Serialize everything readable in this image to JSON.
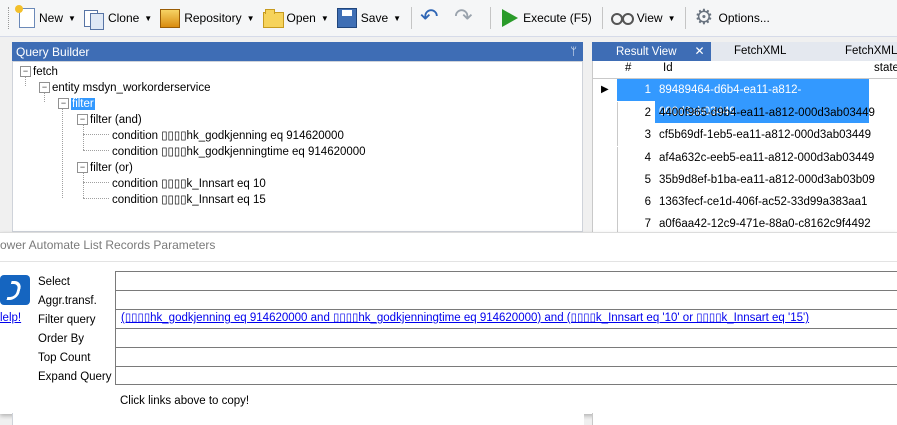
{
  "toolbar": {
    "new": "New",
    "clone": "Clone",
    "repository": "Repository",
    "open": "Open",
    "save": "Save",
    "execute": "Execute (F5)",
    "view": "View",
    "options": "Options..."
  },
  "query_builder": {
    "title": "Query Builder",
    "pin": "ᛘ",
    "tree": {
      "fetch": "fetch",
      "entity": "entity msdyn_workorderservice",
      "filter": "filter",
      "filter_and": "filter (and)",
      "cond1": "condition ▯▯▯▯hk_godkjenning eq 914620000",
      "cond2": "condition ▯▯▯▯hk_godkjenningtime eq 914620000",
      "filter_or": "filter (or)",
      "cond3": "condition ▯▯▯▯k_Innsart eq 10",
      "cond4": "condition ▯▯▯▯k_Innsart eq 15"
    }
  },
  "result_view": {
    "tabs": [
      "Result View",
      "FetchXML",
      "FetchXML"
    ],
    "close": "✕",
    "columns": [
      "#",
      "Id",
      "state"
    ],
    "rows": [
      {
        "n": "1",
        "id": "89489464-d6b4-ea11-a812-000d3ab03449"
      },
      {
        "n": "2",
        "id": "4400f965-d9b4-ea11-a812-000d3ab03449"
      },
      {
        "n": "3",
        "id": "cf5b69df-1eb5-ea11-a812-000d3ab03449"
      },
      {
        "n": "4",
        "id": "af4a632c-eeb5-ea11-a812-000d3ab03449"
      },
      {
        "n": "5",
        "id": "35b9d8ef-b1ba-ea11-a812-000d3ab03b09"
      },
      {
        "n": "6",
        "id": "1363fecf-ce1d-406f-ac52-33d99a383aa1"
      },
      {
        "n": "7",
        "id": "a0f6aa42-12c9-471e-88a0-c8162c9f4492"
      }
    ]
  },
  "pa_dialog": {
    "title": "ower Automate List Records Parameters",
    "help": "lelp!",
    "labels": [
      "Select",
      "Aggr.transf.",
      "Filter query",
      "Order By",
      "Top Count",
      "Expand Query"
    ],
    "filter_query": "(▯▯▯▯hk_godkjenning eq 914620000 and ▯▯▯▯hk_godkjenningtime eq 914620000) and (▯▯▯▯k_Innsart eq '10' or ▯▯▯▯k_Innsart eq '15')",
    "note": "Click links above to copy!"
  },
  "colors": {
    "accent": "#3e6db5",
    "selection": "#3399ff",
    "link": "#0000ee"
  }
}
